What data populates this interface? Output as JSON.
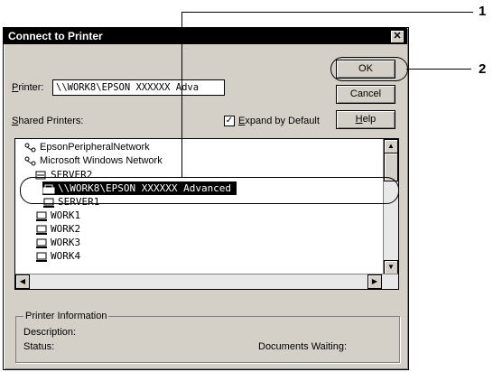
{
  "dialog": {
    "title": "Connect to Printer",
    "close_glyph": "✕"
  },
  "printer_field": {
    "label_prefix": "",
    "label_underlined": "P",
    "label_rest": "rinter:",
    "value": "\\\\WORK8\\EPSON XXXXXX Adva"
  },
  "buttons": {
    "ok": "OK",
    "cancel": "Cancel",
    "help_underlined": "H",
    "help_rest": "elp"
  },
  "shared_printers": {
    "label_underlined": "S",
    "label_rest": "hared Printers:"
  },
  "expand": {
    "checked": "✓",
    "label_underlined": "E",
    "label_rest": "xpand by Default"
  },
  "tree": [
    {
      "label": "EpsonPeripheralNetwork",
      "icon": "network-icon",
      "mono": false
    },
    {
      "label": "Microsoft Windows Network",
      "icon": "network-icon",
      "mono": false
    },
    {
      "label": "SERVER2",
      "icon": "server-icon",
      "mono": true
    },
    {
      "label": "\\\\WORK8\\EPSON XXXXXX Advanced",
      "icon": "printer-icon",
      "mono": true,
      "selected": true
    },
    {
      "label": "SERVER1",
      "icon": "computer-icon",
      "mono": true
    },
    {
      "label": "WORK1",
      "icon": "computer-icon",
      "mono": true
    },
    {
      "label": "WORK2",
      "icon": "computer-icon",
      "mono": true
    },
    {
      "label": "WORK3",
      "icon": "computer-icon",
      "mono": true
    },
    {
      "label": "WORK4",
      "icon": "computer-icon",
      "mono": true
    }
  ],
  "printer_info": {
    "title": "Printer Information",
    "description_label": "Description:",
    "status_label": "Status:",
    "documents_waiting_label": "Documents Waiting:"
  },
  "callouts": {
    "one": "1",
    "two": "2"
  }
}
